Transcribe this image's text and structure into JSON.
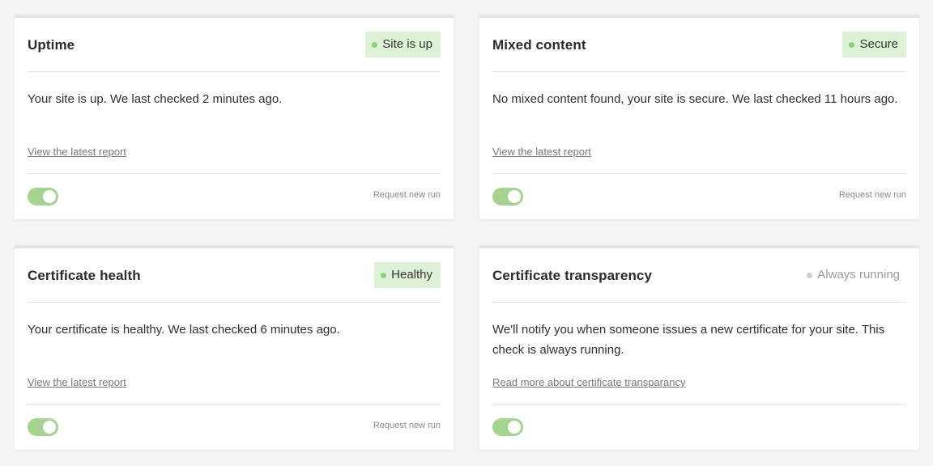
{
  "cards": [
    {
      "title": "Uptime",
      "badge": "Site is up",
      "description": "Your site is up. We last checked 2 minutes ago.",
      "link": "View the latest report",
      "request_run": "Request new run",
      "toggle_on": true
    },
    {
      "title": "Mixed content",
      "badge": "Secure",
      "description": "No mixed content found, your site is secure. We last checked 11 hours ago.",
      "link": "View the latest report",
      "request_run": "Request new run",
      "toggle_on": true
    },
    {
      "title": "Certificate health",
      "badge": "Healthy",
      "description": "Your certificate is healthy. We last checked 6 minutes ago.",
      "link": "View the latest report",
      "request_run": "Request new run",
      "toggle_on": true
    },
    {
      "title": "Certificate transparency",
      "badge": "Always running",
      "description": "We'll notify you when someone issues a new certificate for your site. This check is always running.",
      "link": "Read more about certificate transparancy",
      "toggle_on": true
    }
  ],
  "colors": {
    "page_background": "#f4f4f4",
    "badge_positive_bg": "#ddf2d6",
    "badge_positive_dot": "#8fcf7e",
    "badge_neutral_dot": "#cfcfcf",
    "toggle_on": "#a6d38f"
  },
  "icons": {
    "status_dot": "status-dot-icon",
    "toggle_knob": "toggle-knob-icon"
  }
}
